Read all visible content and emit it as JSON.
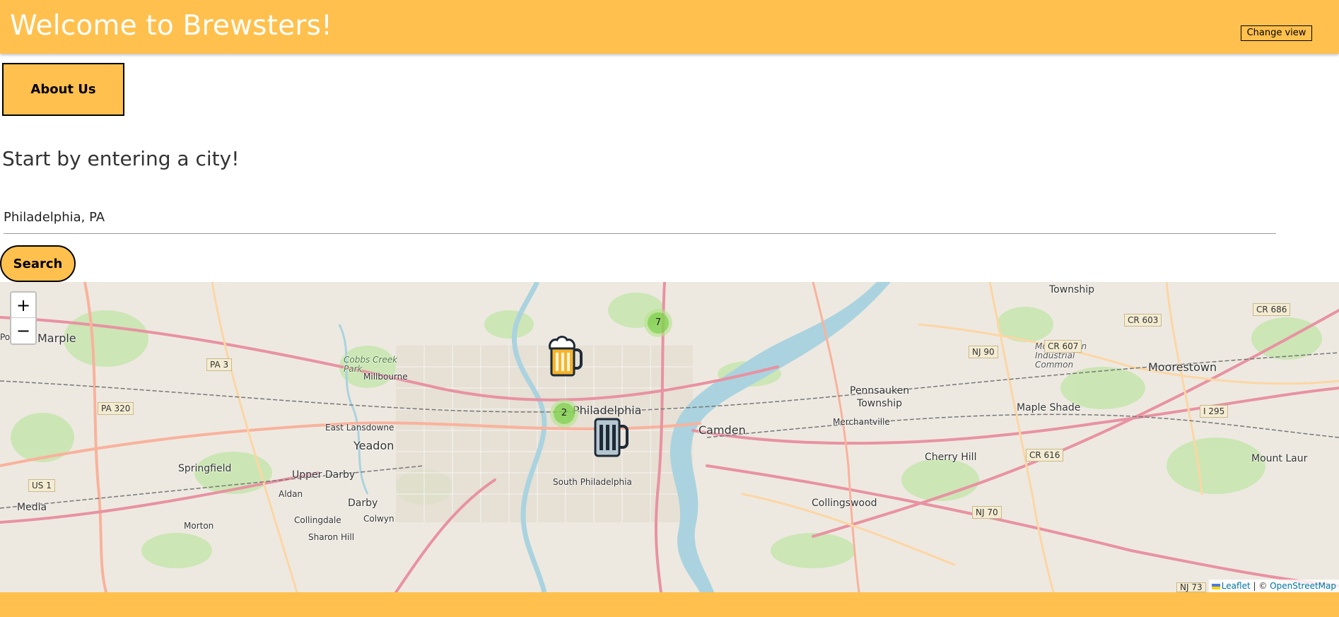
{
  "header": {
    "title": "Welcome to Brewsters!",
    "change_view_label": "Change view"
  },
  "about_button_label": "About Us",
  "prompt": "Start by entering a city!",
  "search": {
    "value": "Philadelphia, PA",
    "button_label": "Search"
  },
  "map": {
    "zoom_in": "+",
    "zoom_out": "−",
    "clusters": [
      {
        "count": "7"
      },
      {
        "count": "2"
      }
    ],
    "markers": [
      {
        "icon": "beer-mug-full-icon"
      },
      {
        "icon": "beer-mug-empty-icon"
      }
    ],
    "labels": {
      "philadelphia": "Philadelphia",
      "camden": "Camden",
      "south_philadelphia": "South Philadelphia",
      "marple": "Marple",
      "yeadon": "Yeadon",
      "springfield": "Springfield",
      "upper_darby": "Upper Darby",
      "darby": "Darby",
      "media": "Media",
      "pennsauken": "Pennsauken\nTownship",
      "maple_shade": "Maple Shade",
      "moorestown": "Moorestown",
      "cherry_hill": "Cherry Hill",
      "collingswood": "Collingswood",
      "township": "Township",
      "east_lansdowne": "East Lansdowne",
      "millbourne": "Millbourne",
      "cobbs_creek": "Cobbs Creek\nPark",
      "aldan": "Aldan",
      "collingdale": "Collingdale",
      "colwyn": "Colwyn",
      "morton": "Morton",
      "sharon_hill": "Sharon Hill",
      "merchantville": "Merchantville",
      "mount_laurel": "Mount Laur",
      "pointe": "Pointe",
      "moorestown_ind": "Moorestown\nIndustrial\nCommon"
    },
    "shields": [
      "PA 3",
      "PA 320",
      "US 1",
      "NJ 90",
      "CR 607",
      "CR 603",
      "CR 686",
      "I 295",
      "CR 616",
      "NJ 70",
      "NJ 73"
    ],
    "attribution": {
      "leaflet": "Leaflet",
      "separator": " | © ",
      "osm": "OpenStreetMap"
    }
  },
  "colors": {
    "accent": "#ffc04d",
    "header_text": "#ffffff"
  }
}
